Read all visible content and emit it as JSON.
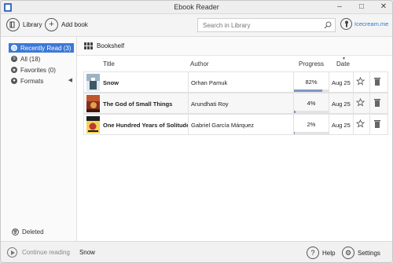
{
  "window": {
    "title": "Ebook Reader",
    "controls": {
      "minimize": "–",
      "maximize": "□",
      "close": "✕"
    }
  },
  "toolbar": {
    "library_label": "Library",
    "add_book_label": "Add book",
    "search_placeholder": "Search in Library",
    "account_label": "Icecream.me"
  },
  "sidebar": {
    "items": [
      {
        "label": "Recently Read (3)",
        "icon": "clock-icon",
        "active": true
      },
      {
        "label": "All (18)",
        "icon": "list-icon",
        "active": false
      },
      {
        "label": "Favorites (0)",
        "icon": "star-icon",
        "active": false
      },
      {
        "label": "Formats",
        "icon": "formats-icon",
        "active": false
      }
    ],
    "deleted_label": "Deleted"
  },
  "main": {
    "view_label": "Bookshelf",
    "columns": {
      "title": "Title",
      "author": "Author",
      "progress": "Progress",
      "date": "Date"
    },
    "books": [
      {
        "title": "Snow",
        "author": "Orhan Pamuk",
        "progress_text": "82%",
        "progress": 0.82,
        "date": "Aug 25",
        "cover_color": "#6d8aa0"
      },
      {
        "title": "The God of Small Things",
        "author": "Arundhati Roy",
        "progress_text": "4%",
        "progress": 0.04,
        "date": "Aug 25",
        "cover_color": "#a44a2c"
      },
      {
        "title": "One Hundred Years of Solitude",
        "author": "Gabriel García Márquez",
        "progress_text": "2%",
        "progress": 0.02,
        "date": "Aug 25",
        "cover_color": "#c9a43a"
      }
    ]
  },
  "bottombar": {
    "continue_label": "Continue reading",
    "continue_book": "Snow",
    "help_label": "Help",
    "settings_label": "Settings"
  },
  "colors": {
    "accent": "#3b78d8",
    "link": "#2a7dc8",
    "progress": "#7d97c2"
  }
}
